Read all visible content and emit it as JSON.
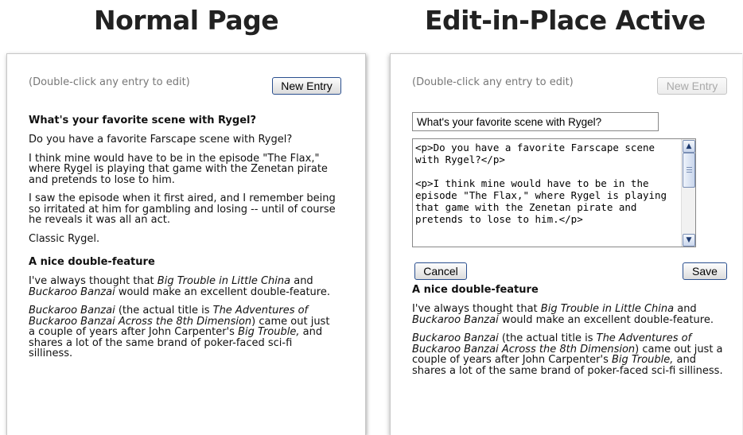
{
  "headings": {
    "left": "Normal Page",
    "right": "Edit-in-Place Active"
  },
  "hint": "(Double-click any entry to edit)",
  "new_entry_label": "New Entry",
  "entries": [
    {
      "title": "What's your favorite scene with Rygel?",
      "paragraphs": [
        "Do you have a favorite Farscape scene with Rygel?",
        "I think mine would have to be in the episode \"The Flax,\" where Rygel is playing that game with the Zenetan pirate and pretends to lose to him.",
        "I saw the episode when it first aired, and I remember being so irritated at him for gambling and losing -- until of course he reveals it was all an act.",
        "Classic Rygel."
      ]
    },
    {
      "title": "A nice double-feature",
      "p1": {
        "a": "I've always thought that ",
        "b": "Big Trouble in Little China",
        "c": " and ",
        "d": "Buckaroo Banzai",
        "e": " would make an excellent double-feature."
      },
      "p2": {
        "a": "Buckaroo Banzai",
        "b": " (the actual title is ",
        "c": "The Adventures of Buckaroo Banzai Across the 8th Dimension",
        "d": ") came out just a couple of years after John Carpenter's ",
        "e": "Big Trouble,",
        "f": " and shares a lot of the same brand of poker-faced sci-fi silliness."
      }
    }
  ],
  "editor": {
    "title_value": "What's your favorite scene with Rygel?",
    "body_value": "<p>Do you have a favorite Farscape scene with Rygel?</p>\n\n<p>I think mine would have to be in the episode \"The Flax,\" where Rygel is playing that game with the Zenetan pirate and pretends to lose to him.</p>",
    "cancel_label": "Cancel",
    "save_label": "Save",
    "scroll_up_glyph": "▲",
    "scroll_down_glyph": "▼"
  }
}
